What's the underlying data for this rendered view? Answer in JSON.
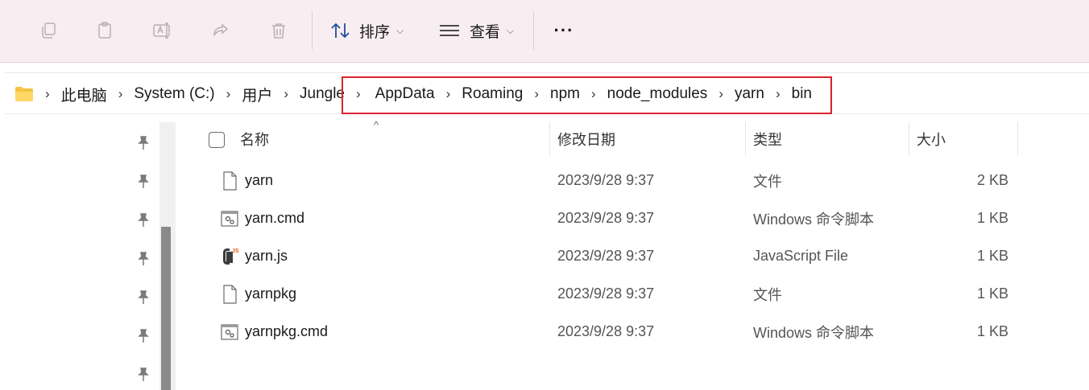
{
  "toolbar": {
    "icons": [
      "copy-icon",
      "paste-icon",
      "rename-icon",
      "share-icon",
      "delete-icon"
    ],
    "sort_label": "排序",
    "view_label": "查看",
    "more_label": "···"
  },
  "address_bar": {
    "crumbs": [
      "此电脑",
      "System (C:)",
      "用户",
      "Jungle",
      "AppData",
      "Roaming",
      "npm",
      "node_modules",
      "yarn",
      "bin"
    ],
    "highlight_color": "#d9232e"
  },
  "columns": {
    "name": "名称",
    "modified": "修改日期",
    "type": "类型",
    "size": "大小"
  },
  "files": [
    {
      "name": "yarn",
      "modified": "2023/9/28 9:37",
      "type": "文件",
      "size": "2 KB",
      "icon": "file-icon"
    },
    {
      "name": "yarn.cmd",
      "modified": "2023/9/28 9:37",
      "type": "Windows 命令脚本",
      "size": "1 KB",
      "icon": "cmd-file-icon"
    },
    {
      "name": "yarn.js",
      "modified": "2023/9/28 9:37",
      "type": "JavaScript File",
      "size": "1 KB",
      "icon": "js-file-icon"
    },
    {
      "name": "yarnpkg",
      "modified": "2023/9/28 9:37",
      "type": "文件",
      "size": "1 KB",
      "icon": "file-icon"
    },
    {
      "name": "yarnpkg.cmd",
      "modified": "2023/9/28 9:37",
      "type": "Windows 命令脚本",
      "size": "1 KB",
      "icon": "cmd-file-icon"
    }
  ]
}
